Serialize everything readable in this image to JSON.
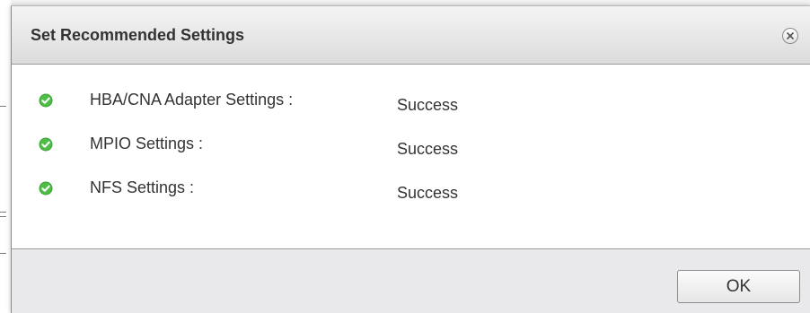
{
  "dialog": {
    "title": "Set Recommended Settings",
    "close_icon": "close-circle-icon"
  },
  "results": [
    {
      "label": "HBA/CNA Adapter Settings :",
      "status": "Success",
      "icon": "check-circle-icon",
      "icon_color": "#3fa83a"
    },
    {
      "label": "MPIO Settings :",
      "status": "Success",
      "icon": "check-circle-icon",
      "icon_color": "#3fa83a"
    },
    {
      "label": "NFS Settings :",
      "status": "Success",
      "icon": "check-circle-icon",
      "icon_color": "#3fa83a"
    }
  ],
  "footer": {
    "ok_label": "OK"
  }
}
